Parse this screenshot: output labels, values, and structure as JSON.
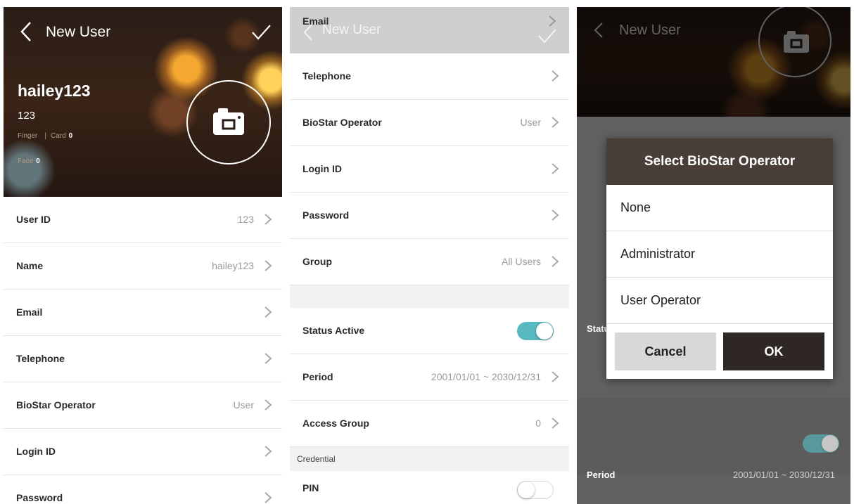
{
  "header": {
    "title": "New User",
    "user_name": "hailey123",
    "user_id": "123",
    "finger_label": "Finger",
    "finger_count": "",
    "card_label": "Card",
    "card_count": "0",
    "face_label": "Face",
    "face_count": "0"
  },
  "fields": {
    "user_id": {
      "label": "User ID",
      "value": "123"
    },
    "name": {
      "label": "Name",
      "value": "hailey123"
    },
    "email": {
      "label": "Email",
      "value": ""
    },
    "telephone": {
      "label": "Telephone",
      "value": ""
    },
    "operator": {
      "label": "BioStar Operator",
      "value": "User"
    },
    "login_id": {
      "label": "Login ID",
      "value": ""
    },
    "password": {
      "label": "Password",
      "value": ""
    },
    "group": {
      "label": "Group",
      "value": "All Users"
    },
    "status": {
      "label": "Status Active",
      "on": true
    },
    "period": {
      "label": "Period",
      "value": "2001/01/01 ~ 2030/12/31"
    },
    "access_group": {
      "label": "Access Group",
      "value": "0"
    },
    "credential_header": "Credential",
    "pin": {
      "label": "PIN",
      "on": false
    }
  },
  "dialog": {
    "title": "Select BioStar Operator",
    "options": [
      "None",
      "Administrator",
      "User Operator"
    ],
    "cancel_label": "Cancel",
    "ok_label": "OK"
  },
  "peek": {
    "user_id_label": "User ID",
    "user_id_value": "123",
    "name_label": "Name",
    "email_label": "Email",
    "telephone_label": "Telephone",
    "operator_label": "BioStar Operator",
    "group_label": "Group"
  },
  "colors": {
    "accent_toggle": "#58b9c0",
    "dialog_header": "#4a3e38",
    "ok_button": "#2f2724"
  }
}
